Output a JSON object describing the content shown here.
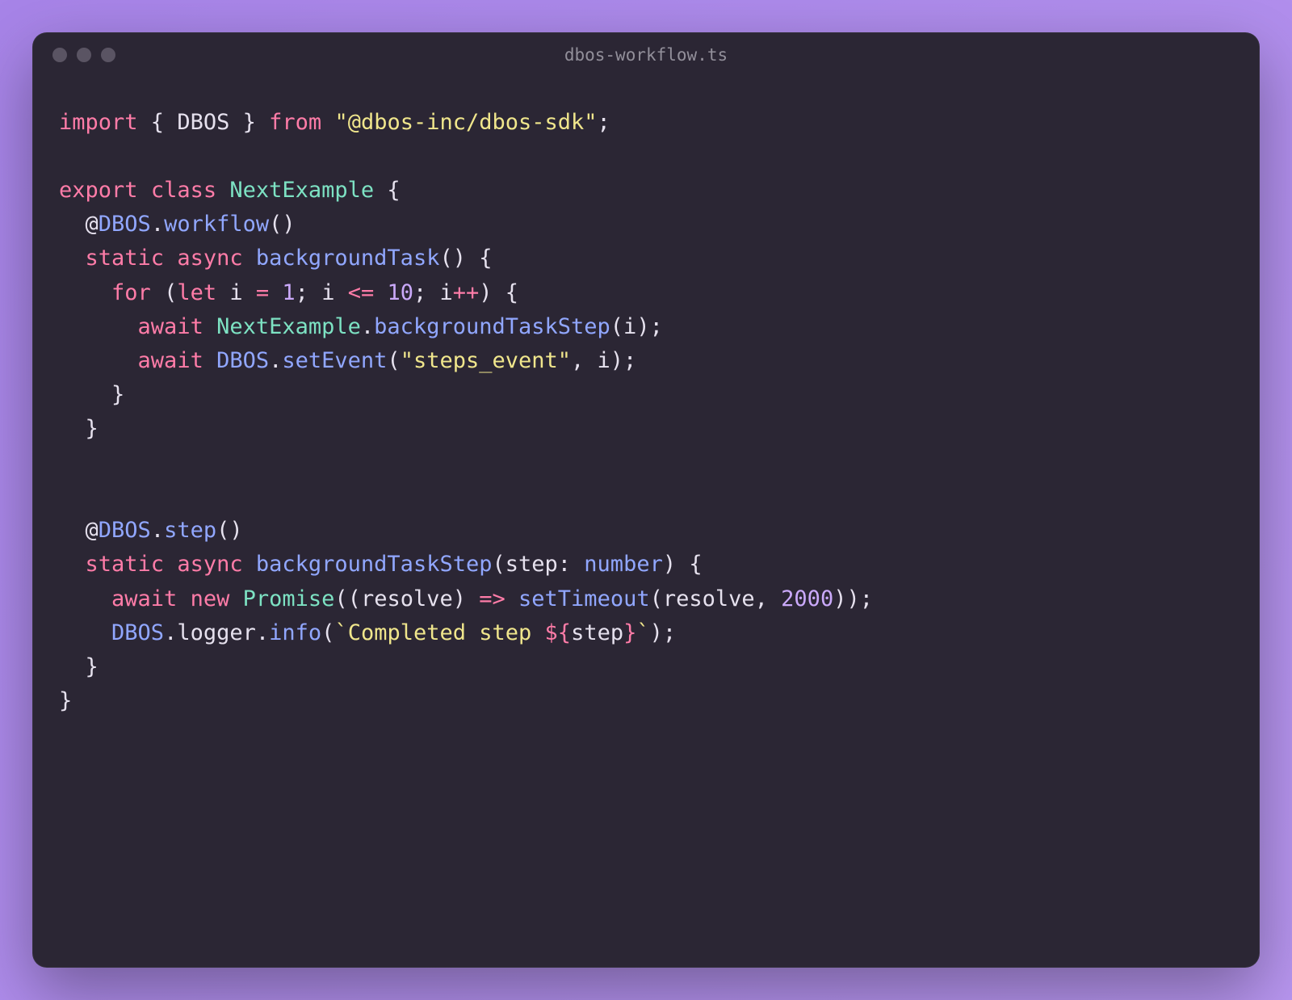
{
  "window": {
    "title": "dbos-workflow.ts"
  },
  "code": {
    "line1": {
      "import": "import",
      "lbrace": " { ",
      "dbos": "DBOS",
      "rbrace": " } ",
      "from": "from",
      "sp": " ",
      "mod": "\"@dbos-inc/dbos-sdk\"",
      "semi": ";"
    },
    "line3": {
      "export": "export",
      "class": "class",
      "name": "NextExample",
      "lbrace": " {"
    },
    "line4": {
      "indent": "  ",
      "at": "@",
      "dbos": "DBOS",
      "dot": ".",
      "method": "workflow",
      "paren": "()"
    },
    "line5": {
      "indent": "  ",
      "static": "static",
      "async": "async",
      "name": "backgroundTask",
      "paren": "() {"
    },
    "line6": {
      "indent": "    ",
      "for": "for",
      "open": " (",
      "let": "let",
      "var": " i ",
      "eq": "=",
      "one": " 1",
      "semi1": "; ",
      "i2": "i ",
      "lte": "<=",
      "ten": " 10",
      "semi2": "; ",
      "i3": "i",
      "inc": "++",
      "close": ") {"
    },
    "line7": {
      "indent": "      ",
      "await": "await",
      "cls": " NextExample",
      "dot": ".",
      "fn": "backgroundTaskStep",
      "open": "(",
      "arg": "i",
      "close": ");"
    },
    "line8": {
      "indent": "      ",
      "await": "await",
      "dbos": " DBOS",
      "dot": ".",
      "fn": "setEvent",
      "open": "(",
      "str": "\"steps_event\"",
      "comma": ", ",
      "arg": "i",
      "close": ");"
    },
    "line9": {
      "indent": "    ",
      "brace": "}"
    },
    "line10": {
      "indent": "  ",
      "brace": "}"
    },
    "line13": {
      "indent": "  ",
      "at": "@",
      "dbos": "DBOS",
      "dot": ".",
      "method": "step",
      "paren": "()"
    },
    "line14": {
      "indent": "  ",
      "static": "static",
      "async": "async",
      "name": "backgroundTaskStep",
      "open": "(",
      "param": "step",
      "colon": ": ",
      "type": "number",
      "close": ") {"
    },
    "line15": {
      "indent": "    ",
      "await": "await",
      "new": "new",
      "promise": "Promise",
      "open": "((",
      "resolve1": "resolve",
      "mid": ") ",
      "arrow": "=>",
      "sp": " ",
      "st": "setTimeout",
      "open2": "(",
      "resolve2": "resolve",
      "comma": ", ",
      "ms": "2000",
      "close": "));"
    },
    "line16": {
      "indent": "    ",
      "dbos": "DBOS",
      "dot1": ".",
      "logger": "logger",
      "dot2": ".",
      "info": "info",
      "open": "(",
      "tick1": "`",
      "text": "Completed step ",
      "interpOpen": "${",
      "var": "step",
      "interpClose": "}",
      "tick2": "`",
      "close": ");"
    },
    "line17": {
      "indent": "  ",
      "brace": "}"
    },
    "line18": {
      "brace": "}"
    }
  }
}
